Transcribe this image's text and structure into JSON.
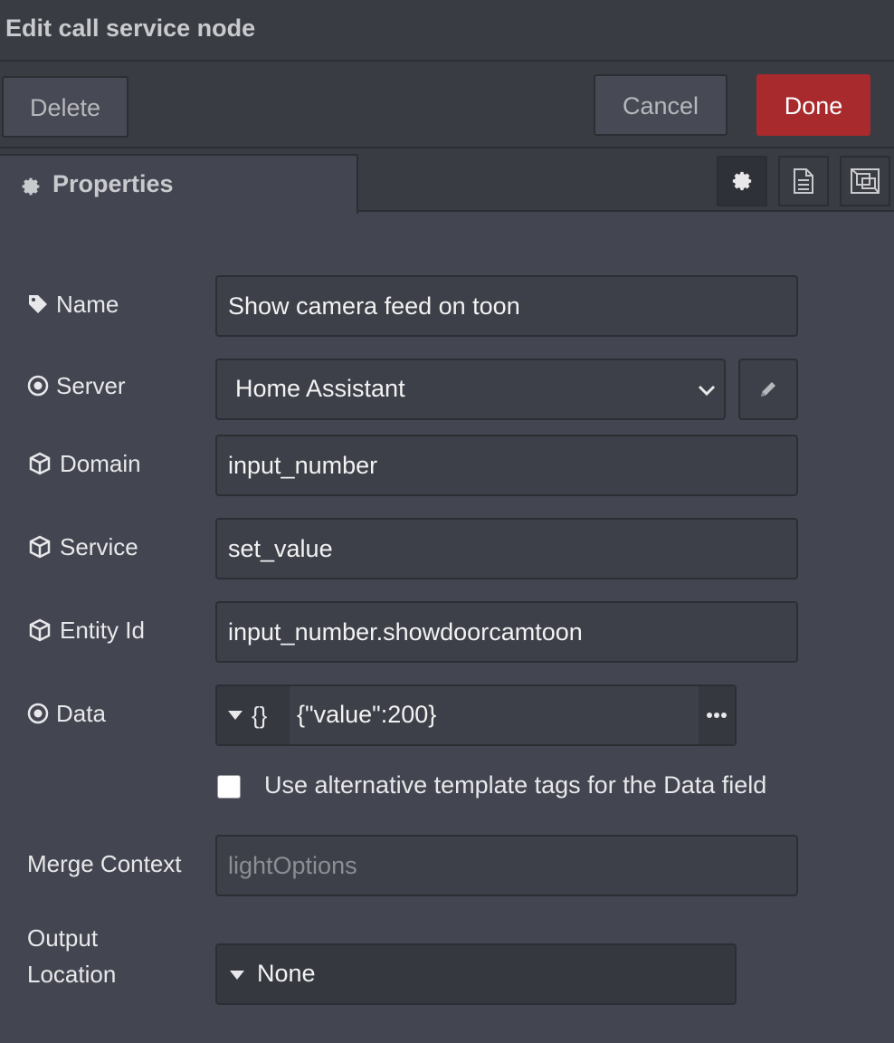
{
  "dialog": {
    "title": "Edit call service node",
    "delete_label": "Delete",
    "cancel_label": "Cancel",
    "done_label": "Done"
  },
  "tabs": {
    "properties_label": "Properties",
    "icons": [
      "gear-icon",
      "document-icon",
      "layout-icon"
    ]
  },
  "fields": {
    "name": {
      "label": "Name",
      "value": "Show camera feed on toon"
    },
    "server": {
      "label": "Server",
      "value": "Home Assistant"
    },
    "domain": {
      "label": "Domain",
      "value": "input_number"
    },
    "service": {
      "label": "Service",
      "value": "set_value"
    },
    "entity_id": {
      "label": "Entity Id",
      "value": "input_number.showdoorcamtoon"
    },
    "data": {
      "label": "Data",
      "type_glyph": "{}",
      "value": "{\"value\":200}"
    },
    "alt_tags": {
      "label": "Use alternative template tags for the Data field",
      "checked": false
    },
    "merge_context": {
      "label": "Merge Context",
      "placeholder": "lightOptions"
    },
    "output_location": {
      "label_line1": "Output",
      "label_line2": "Location",
      "value": "None"
    }
  },
  "colors": {
    "done_button": "#a82a2d",
    "background": "#434651"
  }
}
